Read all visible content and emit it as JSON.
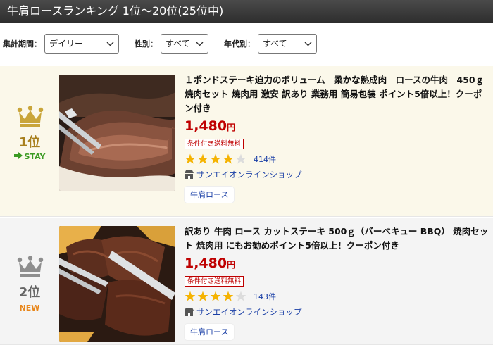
{
  "header": {
    "title": "牛肩ロースランキング 1位〜20位(25位中)"
  },
  "filters": {
    "period_label": "集計期間：",
    "period_value": "デイリー",
    "gender_label": "性別：",
    "gender_value": "すべて",
    "age_label": "年代別：",
    "age_value": "すべて"
  },
  "items": [
    {
      "rank": "1位",
      "status": "STAY",
      "crown_color": "#c9a53a",
      "title": "１ポンドステーキ迫力のボリューム　柔かな熟成肉　ロースの牛肉　450ｇ 焼肉セット 焼肉用 激安 訳あり 業務用 簡易包装 ポイント5倍以上！クーポン付き",
      "price": "1,480",
      "price_unit": "円",
      "shipping": "条件付き送料無料",
      "rating": 4,
      "review_count": "414件",
      "shop": "サンエイオンラインショップ",
      "tag": "牛肩ロース"
    },
    {
      "rank": "2位",
      "status": "NEW",
      "crown_color": "#8e8e8e",
      "title": "訳あり 牛肉 ロース カットステーキ 500ｇ（バーベキュー BBQ） 焼肉セット 焼肉用 にもお勧めポイント5倍以上！クーポン付き",
      "price": "1,480",
      "price_unit": "円",
      "shipping": "条件付き送料無料",
      "rating": 4,
      "review_count": "143件",
      "shop": "サンエイオンラインショップ",
      "tag": "牛肩ロース"
    }
  ],
  "colors": {
    "price": "#bf0000",
    "link": "#1a3fa6",
    "star": "#f5b301",
    "stay": "#3a9a22",
    "new": "#e8861a"
  },
  "icons": [
    "crown-icon",
    "arrow-right-icon",
    "star-icon",
    "shop-icon",
    "chevron-down-icon"
  ]
}
